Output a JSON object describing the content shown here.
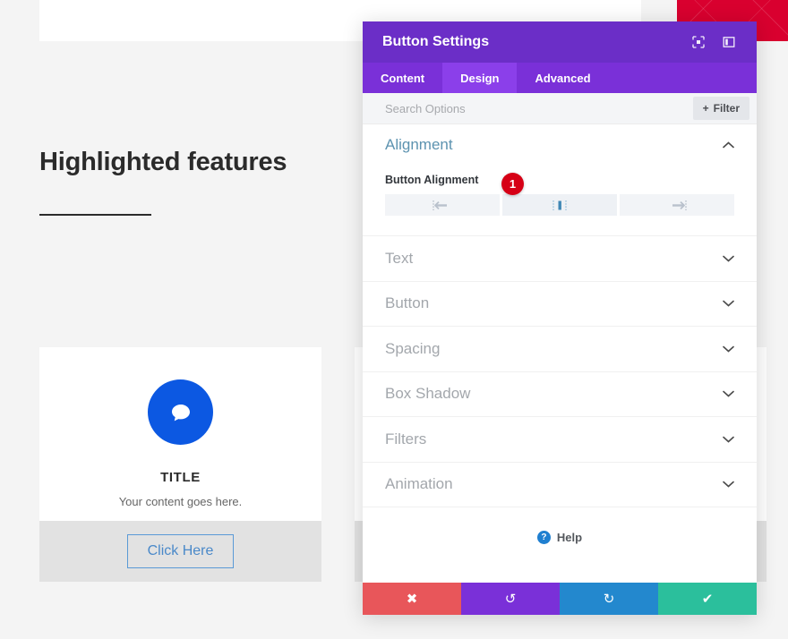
{
  "page": {
    "heading": "Highlighted features",
    "card": {
      "icon": "chat-bubble-icon",
      "title": "TITLE",
      "text": "Your content goes here.",
      "button_label": "Click Here"
    },
    "banner_color": "#d9002f",
    "icon_color": "#0c58e2"
  },
  "modal": {
    "title": "Button Settings",
    "header_icons": [
      {
        "name": "expand-view-icon"
      },
      {
        "name": "split-view-icon"
      }
    ],
    "tabs": [
      {
        "label": "Content",
        "active": false
      },
      {
        "label": "Design",
        "active": true
      },
      {
        "label": "Advanced",
        "active": false
      }
    ],
    "search": {
      "placeholder": "Search Options",
      "value": ""
    },
    "filter_label": "Filter",
    "filter_plus": "+",
    "open_section": {
      "title": "Alignment",
      "chevron": "collapse-chevron-up-icon",
      "field_label": "Button Alignment",
      "options": [
        {
          "name": "align-left",
          "selected": false
        },
        {
          "name": "align-center",
          "selected": true
        },
        {
          "name": "align-right",
          "selected": false
        }
      ],
      "badge": "1"
    },
    "sections": [
      {
        "title": "Text"
      },
      {
        "title": "Button"
      },
      {
        "title": "Spacing"
      },
      {
        "title": "Box Shadow"
      },
      {
        "title": "Filters"
      },
      {
        "title": "Animation"
      }
    ],
    "help_label": "Help",
    "help_icon_glyph": "?",
    "footer_buttons": [
      {
        "name": "cancel-button",
        "glyph": "✖",
        "color": "#e8565a"
      },
      {
        "name": "undo-button",
        "glyph": "↺",
        "color": "#7a30d8"
      },
      {
        "name": "redo-button",
        "glyph": "↻",
        "color": "#2388ce"
      },
      {
        "name": "save-button",
        "glyph": "✔",
        "color": "#2bbf9c"
      }
    ]
  }
}
